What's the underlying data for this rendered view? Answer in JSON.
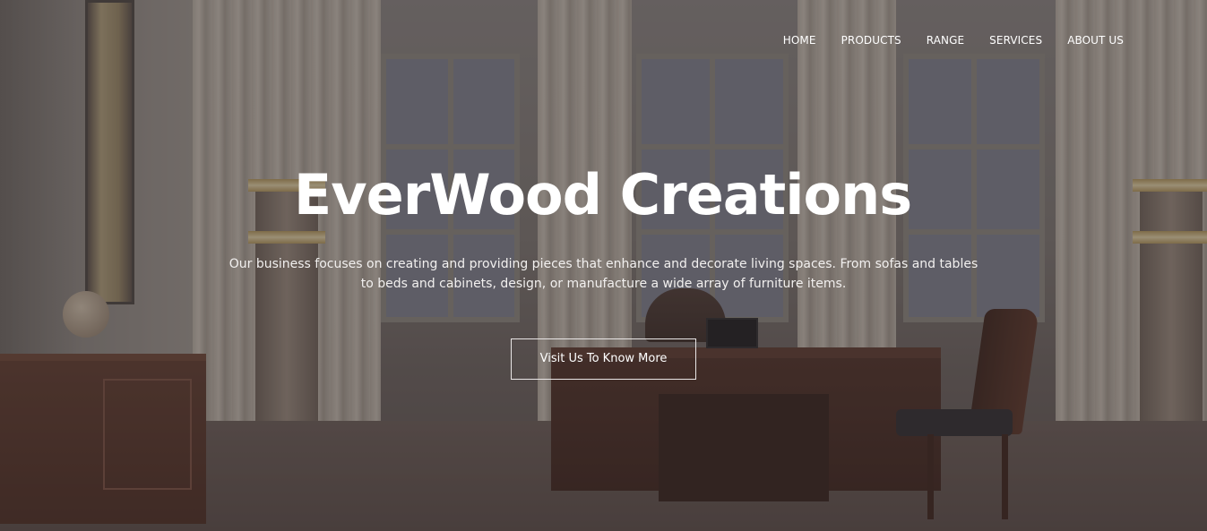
{
  "nav": {
    "items": [
      {
        "label": "HOME"
      },
      {
        "label": "PRODUCTS"
      },
      {
        "label": "RANGE"
      },
      {
        "label": "SERVICES"
      },
      {
        "label": "ABOUT US"
      }
    ]
  },
  "hero": {
    "title": "EverWood Creations",
    "tagline": "Our business focuses on creating and providing pieces that enhance and decorate living spaces. From sofas and tables to beds and cabinets, design, or manufacture a wide array of furniture items.",
    "cta_label": "Visit Us To Know More",
    "background_icon": "office-interior-photo"
  },
  "colors": {
    "text": "#ffffff",
    "overlay": "rgba(50, 42, 45, 0.42)",
    "cta_border": "#e9e6e6"
  }
}
